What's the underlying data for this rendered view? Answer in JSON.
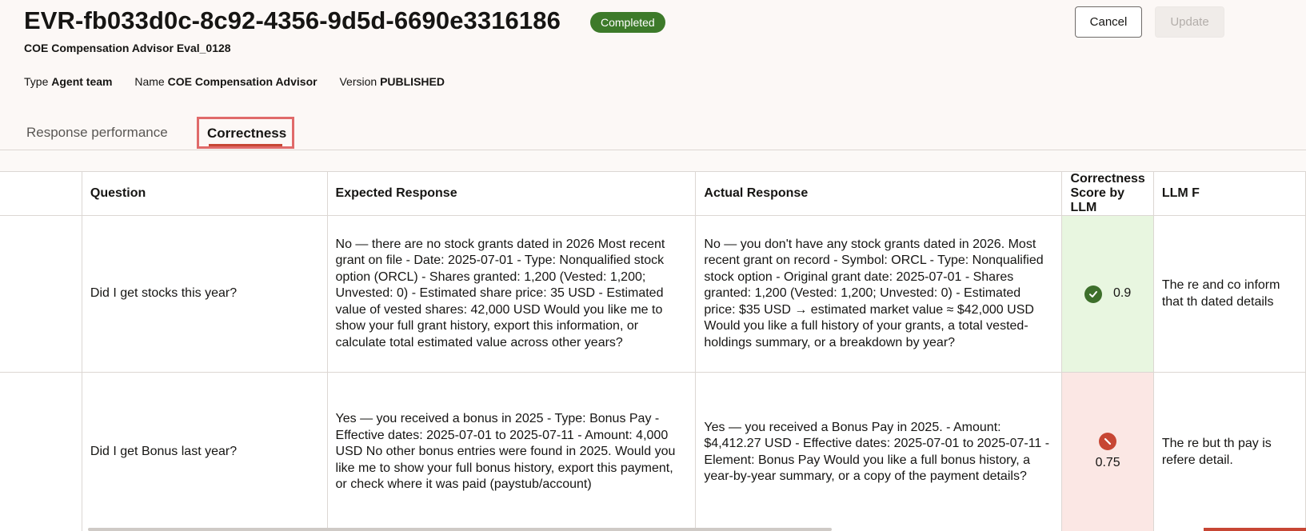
{
  "header": {
    "title": "EVR-fb033d0c-8c92-4356-9d5d-6690e3316186",
    "status": "Completed",
    "subtitle": "COE Compensation Advisor Eval_0128",
    "meta": {
      "type_label": "Type",
      "type_value": "Agent team",
      "name_label": "Name",
      "name_value": "COE Compensation Advisor",
      "version_label": "Version",
      "version_value": "PUBLISHED"
    },
    "cancel_label": "Cancel",
    "update_label": "Update"
  },
  "tabs": [
    {
      "label": "Response performance",
      "selected": false
    },
    {
      "label": "Correctness",
      "selected": true
    }
  ],
  "table": {
    "columns": [
      "",
      "Question",
      "Expected Response",
      "Actual Response",
      "Correctness Score by LLM",
      "LLM F"
    ],
    "rows": [
      {
        "question": "Did I get stocks this year?",
        "expected": "No — there are no stock grants dated in 2026 Most recent grant on file - Date: 2025-07-01 - Type: Nonqualified stock option (ORCL) - Shares granted: 1,200 (Vested: 1,200; Unvested: 0) - Estimated share price: 35 USD - Estimated value of vested shares: 42,000 USD Would you like me to show your full grant history, export this information, or calculate total estimated value across other years?",
        "actual": "No — you don't have any stock grants dated in 2026. Most recent grant on record - Symbol: ORCL - Type: Nonqualified stock option - Original grant date: 2025-07-01 - Shares granted: 1,200 (Vested: 1,200; Unvested: 0) - Estimated price: $35 USD → estimated market value ≈ $42,000 USD Would you like a full history of your grants, a total vested-holdings summary, or a breakdown by year?",
        "score": "0.9",
        "score_status": "pass",
        "feedback": "The re and co inform that th dated details"
      },
      {
        "question": "Did I get Bonus last year?",
        "expected": "Yes — you received a bonus in 2025 - Type: Bonus Pay - Effective dates: 2025-07-01 to 2025-07-11 - Amount: 4,000 USD No other bonus entries were found in 2025. Would you like me to show your full bonus history, export this payment, or check where it was paid (paystub/account)",
        "actual": "Yes — you received a Bonus Pay in 2025. - Amount: $4,412.27 USD - Effective dates: 2025-07-01 to 2025-07-11 - Element: Bonus Pay Would you like a full bonus history, a year-by-year summary, or a copy of the payment details?",
        "score": "0.75",
        "score_status": "fail",
        "feedback": "The re but th pay is refere detail."
      }
    ]
  },
  "colors": {
    "badge": "#3d7a2a",
    "pass_bg": "#e8f6e0",
    "fail_bg": "#fbe7e4",
    "accent": "#c74634"
  }
}
